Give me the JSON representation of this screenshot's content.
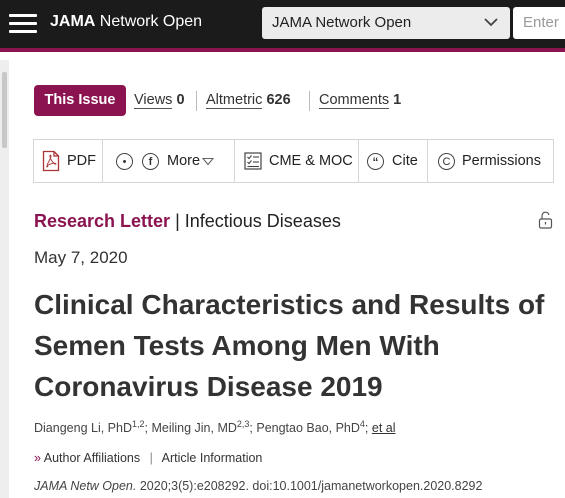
{
  "header": {
    "brand_bold": "JAMA",
    "brand_rest": " Network Open",
    "journal_select_value": "JAMA Network Open",
    "search_placeholder": "Enter"
  },
  "metrics": {
    "this_issue": "This Issue",
    "views_label": "Views",
    "views_count": "0",
    "altmetric_label": "Altmetric",
    "altmetric_count": "626",
    "comments_label": "Comments",
    "comments_count": "1"
  },
  "toolbar": {
    "pdf": "PDF",
    "more": "More",
    "cme": "CME & MOC",
    "cite": "Cite",
    "permissions": "Permissions"
  },
  "article": {
    "type": "Research Letter",
    "divider": " | ",
    "topic": "Infectious Diseases",
    "date": "May 7, 2020",
    "title": "Clinical Characteristics and Results of Semen Tests Among Men With Coronavirus Disease 2019",
    "authors": [
      {
        "name": "Diangeng Li, PhD",
        "sup": "1,2"
      },
      {
        "name": "Meiling Jin, MD",
        "sup": "2,3"
      },
      {
        "name": "Pengtao Bao, PhD",
        "sup": "4"
      }
    ],
    "et_al": "et al",
    "author_affiliations": "Author Affiliations",
    "article_information": "Article Information",
    "journal_abbrev": "JAMA Netw Open.",
    "citation_rest": " 2020;3(5):e208292. doi:10.1001/jamanetworkopen.2020.8292"
  }
}
